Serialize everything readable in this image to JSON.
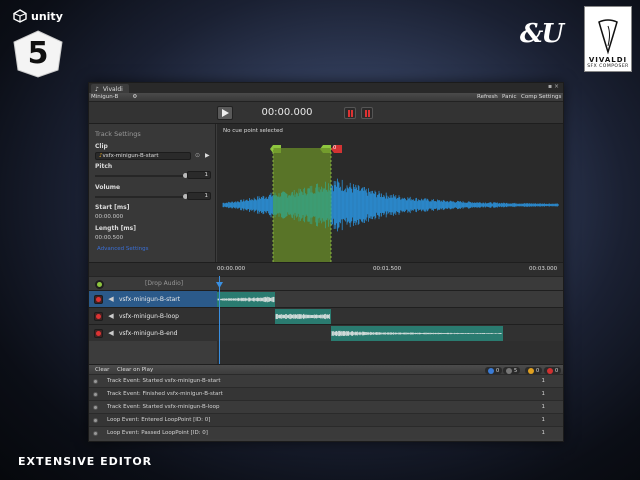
{
  "brand": {
    "unity_label": "unity",
    "five_label": "5",
    "au_label": "&U",
    "vivaldi_title": "VIVALDI",
    "vivaldi_sub": "SFX COMPOSER",
    "caption": "EXTENSIVE EDITOR"
  },
  "window": {
    "tab_title": "Vivaldi",
    "file_tab": "Minigun-B",
    "toolbar": [
      "Refresh",
      "Panic",
      "Comp Settings"
    ]
  },
  "transport": {
    "time": "00:00.000"
  },
  "track_settings": {
    "heading": "Track Settings",
    "clip_label": "Clip",
    "clip_value": "vsfx-minigun-B-start",
    "pitch_label": "Pitch",
    "pitch_value": "1",
    "volume_label": "Volume",
    "volume_value": "1",
    "start_label": "Start [ms]",
    "start_value": "00:00.000",
    "length_label": "Length [ms]",
    "length_value": "00:00.500",
    "advanced_link": "Advanced Settings"
  },
  "waveform": {
    "cue_status": "No cue point selected",
    "marker_label": "0"
  },
  "timeline": {
    "ticks": [
      "00:00.000",
      "00:01.500",
      "00:03.000"
    ]
  },
  "drop_label": "[Drop Audio]",
  "tracks": [
    {
      "name": "vsfx-minigun-B-start"
    },
    {
      "name": "vsfx-minigun-B-loop"
    },
    {
      "name": "vsfx-minigun-B-end"
    }
  ],
  "console": {
    "clear": "Clear",
    "clear_on_play": "Clear on Play",
    "counts": [
      {
        "value": "0",
        "color": "#3a7bd5"
      },
      {
        "value": "5",
        "color": "#2a2a2a"
      },
      {
        "value": "0",
        "color": "#e0a020"
      },
      {
        "value": "0",
        "color": "#d03030"
      }
    ],
    "logs": [
      {
        "text": "Track Event: Started vsfx-minigun-B-start",
        "count": "1"
      },
      {
        "text": "Track Event: Finished vsfx-minigun-B-start",
        "count": "1"
      },
      {
        "text": "Track Event: Started vsfx-minigun-B-loop",
        "count": "1"
      },
      {
        "text": "Loop Event: Entered LoopPoint [ID: 0]",
        "count": "1"
      },
      {
        "text": "Loop Event: Passed LoopPoint [ID: 0]",
        "count": "1"
      }
    ]
  },
  "colors": {
    "wave_blue": "#2b8fd6",
    "wave_green": "#3aa07a",
    "region_green": "#6a8e28",
    "accent_red": "#d33333"
  }
}
